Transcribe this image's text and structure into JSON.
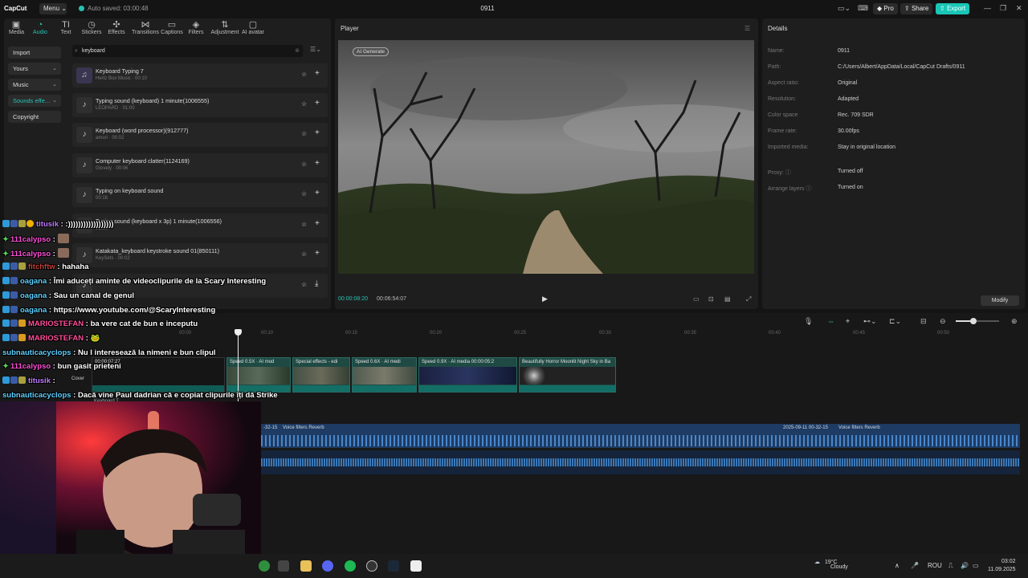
{
  "titlebar": {
    "app_name": "CapCut",
    "menu_label": "Menu",
    "autosave_text": "Auto saved: 03:00:48",
    "project_title": "0911",
    "pro_label": "Pro",
    "share_label": "Share",
    "export_label": "Export"
  },
  "media_toolbar": [
    "Media",
    "Audio",
    "Text",
    "Stickers",
    "Effects",
    "Transitions",
    "Captions",
    "Filters",
    "Adjustment",
    "AI avatar"
  ],
  "audio_sidebar": [
    "Import",
    "Yours",
    "Music",
    "Sounds effe...",
    "Copyright"
  ],
  "search": {
    "value": "keyboard"
  },
  "sounds": [
    {
      "name": "Keyboard Typing 7",
      "meta": "Hertz Box Music · 00:10"
    },
    {
      "name": "Typing sound (keyboard) 1 minute(1006555)",
      "meta": "LEOPARD · 01:00"
    },
    {
      "name": "Keyboard (word processor)(912777)",
      "meta": "amuri · 00:02"
    },
    {
      "name": "Computer keyboard clatter(1124169)",
      "meta": "Glovely · 00:06"
    },
    {
      "name": "Typing on keyboard sound",
      "meta": "00:16"
    },
    {
      "name": "Typing sound (keyboard x 3p) 1 minute(1006556)",
      "meta": "01:00"
    },
    {
      "name": "Katakata_keyboard keystroke sound 01(850111)",
      "meta": "KeySets · 00:02"
    }
  ],
  "player": {
    "title": "Player",
    "ai_badge": "AI Generate",
    "time_current": "00:00:08:20",
    "time_total": "00:06:54:07"
  },
  "details": {
    "title": "Details",
    "rows": [
      {
        "label": "Name:",
        "value": "0911"
      },
      {
        "label": "Path:",
        "value": "C:/Users/Albert/AppData/Local/CapCut Drafts/0911"
      },
      {
        "label": "Aspect ratio:",
        "value": "Original"
      },
      {
        "label": "Resolution:",
        "value": "Adapted"
      },
      {
        "label": "Color space",
        "value": "Rec. 709 SDR"
      },
      {
        "label": "Frame rate:",
        "value": "30.00fps"
      },
      {
        "label": "Imported media:",
        "value": "Stay in original location"
      },
      {
        "label": "Proxy: ⓘ",
        "value": "Turned off"
      },
      {
        "label": "Arrange layers ⓘ",
        "value": "Turned on"
      }
    ],
    "modify_label": "Modify"
  },
  "timeline": {
    "ticks": [
      "00:00",
      "00:10",
      "00:15",
      "00:20",
      "00:25",
      "00:30",
      "00:35",
      "00:40",
      "00:45",
      "00:50"
    ],
    "main_clip_time": "00:00:07:27",
    "clips": [
      "Speed 0.5X",
      "AI mod",
      "Special effects - edi",
      "Speed 0.6X",
      "AI medi",
      "Speed 0.9X",
      "AI media",
      "00:00:05:2",
      "Beautifully Horror Moonlit Night Sky in Ba"
    ],
    "cover_label": "Cover",
    "keyboard_label": "Keyboard T",
    "audio_labels": [
      "-32-15",
      "Voice filters Reverb",
      "2025-09-11 00-32-15",
      "Voice filters Reverb"
    ]
  },
  "chat": [
    {
      "user": "titusik",
      "text": ": :))))))))))))))))))",
      "color": "#c07cff"
    },
    {
      "user": "111calypso",
      "text": ":",
      "color": "#ff4fd8",
      "emote": true
    },
    {
      "user": "111calypso",
      "text": ":",
      "color": "#ff4fd8",
      "emote": true
    },
    {
      "user": "fitchftw",
      "text": ": hahaha",
      "color": "#c0403a"
    },
    {
      "user": "oagana",
      "text": ": Îmi aduceți aminte de videoclipurile de la Scary Interesting",
      "color": "#5fd0ff"
    },
    {
      "user": "oagana",
      "text": ": Sau un canal de genul",
      "color": "#5fd0ff"
    },
    {
      "user": "oagana",
      "text": ": https://www.youtube.com/@ScaryInteresting",
      "color": "#5fd0ff"
    },
    {
      "user": "MARIOSTEFAN",
      "text": ": ba vere cat de bun e inceputu",
      "color": "#ff4f9a"
    },
    {
      "user": "MARIOSTEFAN",
      "text": ": 🐸",
      "color": "#ff4f9a"
    },
    {
      "user": "subnauticacyclops",
      "text": ": Nu I interesează la nimeni e bun clipul",
      "color": "#5fd0ff"
    },
    {
      "user": "111calypso",
      "text": ": bun gasit prieteni",
      "color": "#ff4fd8"
    },
    {
      "user": "titusik",
      "text": ":",
      "color": "#c07cff"
    },
    {
      "user": "subnauticacyclops",
      "text": ": Dacă vine Paul dadrian că e copiat clipurile îți dă Strike",
      "color": "#5fd0ff"
    }
  ],
  "taskbar": {
    "temperature": "19°C",
    "weather": "Cloudy",
    "language": "ROU",
    "time": "03:02",
    "date": "11.09.2025"
  },
  "colors": {
    "accent": "#27c1b4",
    "panel": "#1e1e1e",
    "audio_track": "#1d3b63"
  }
}
